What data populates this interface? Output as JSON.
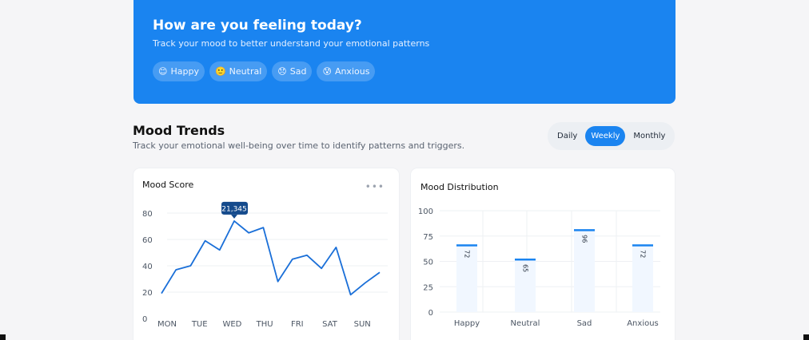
{
  "hero": {
    "title": "How are you feeling today?",
    "subtitle": "Track your mood to better understand your emotional patterns",
    "moods": [
      {
        "emoji": "😊",
        "label": "Happy"
      },
      {
        "emoji": "🙂",
        "label": "Neutral"
      },
      {
        "emoji": "😞",
        "label": "Sad"
      },
      {
        "emoji": "😰",
        "label": "Anxious"
      }
    ]
  },
  "trends": {
    "title": "Mood Trends",
    "subtitle": "Track your emotional well-being over time to identify patterns and triggers.",
    "periods": [
      "Daily",
      "Weekly",
      "Monthly"
    ],
    "active_period": "Weekly"
  },
  "mood_score": {
    "title": "Mood Score",
    "more_icon": "more-horizontal-icon",
    "tooltip": "21,345"
  },
  "distribution": {
    "title": "Mood Distribution"
  },
  "colors": {
    "accent": "#1a84f0",
    "line": "#1a6fd8",
    "tooltip_bg": "#144a8c"
  },
  "chart_data": [
    {
      "type": "line",
      "title": "Mood Score",
      "categories": [
        "MON",
        "TUE",
        "WED",
        "THU",
        "FRI",
        "SAT",
        "SUN"
      ],
      "x": [
        0,
        0.33,
        0.67,
        1,
        1.33,
        1.67,
        2,
        2.33,
        2.67,
        3,
        3.33,
        3.67,
        4,
        4.33,
        4.67,
        5,
        5.33,
        5.67,
        6,
        6.33
      ],
      "values": [
        19,
        37,
        40,
        59,
        52,
        74,
        65,
        69,
        28,
        45,
        48,
        38,
        54,
        18,
        27,
        35
      ],
      "yticks": [
        0,
        20,
        40,
        60,
        80
      ],
      "ylim": [
        0,
        80
      ],
      "grid": true,
      "annotation": {
        "label": "21,345",
        "index": 5
      }
    },
    {
      "type": "bar",
      "title": "Mood Distribution",
      "categories": [
        "Happy",
        "Neutral",
        "Sad",
        "Anxious"
      ],
      "values": [
        72,
        65,
        96,
        72
      ],
      "bar_levels": [
        66,
        52,
        81,
        66
      ],
      "yticks": [
        0,
        25,
        50,
        75,
        100
      ],
      "ylim": [
        0,
        100
      ],
      "grid": true
    }
  ]
}
